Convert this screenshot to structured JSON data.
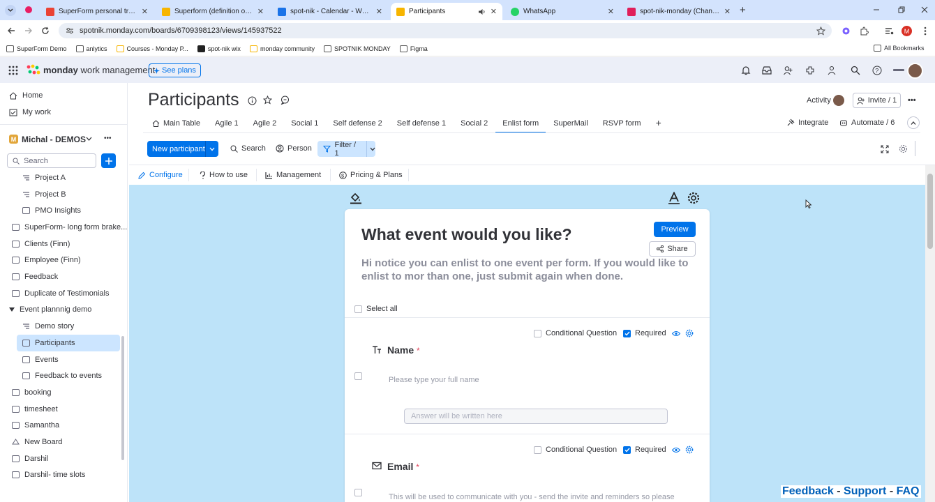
{
  "browser": {
    "tabs": [
      {
        "label": "SuperForm personal training -",
        "color": "#ea4335"
      },
      {
        "label": "Superform (definition of creati",
        "color": "#f7b500"
      },
      {
        "label": "spot-nik - Calendar - Week of J",
        "color": "#1a73e8"
      },
      {
        "label": "Participants",
        "color": "#f7b500",
        "active": true
      },
      {
        "label": "WhatsApp",
        "color": "#25d366"
      },
      {
        "label": "spot-nik-monday (Channel) - S",
        "color": "#e01e5a"
      }
    ],
    "close_glyph": "✕",
    "new_tab_glyph": "+",
    "url": "spotnik.monday.com/boards/6709398123/views/145937522",
    "profile_initial": "M",
    "bookmarks": [
      "SuperForm Demo",
      "anlytics",
      "Courses - Monday P...",
      "spot-nik wix",
      "monday community",
      "SPOTNIK MONDAY",
      "Figma"
    ],
    "all_bookmarks": "All Bookmarks"
  },
  "app": {
    "brand_bold": "monday",
    "brand_light": "work management",
    "see_plans": "See plans",
    "accent": "#0073ea"
  },
  "sidebar": {
    "home": "Home",
    "my_work": "My work",
    "workspace_initial": "M",
    "workspace": "Michal - DEMOS",
    "more": "•••",
    "search_placeholder": "Search",
    "items": [
      {
        "label": "Project A",
        "indent": true
      },
      {
        "label": "Project B",
        "indent": true
      },
      {
        "label": "PMO Insights",
        "indent": true
      },
      {
        "label": "SuperForm- long form brake..."
      },
      {
        "label": "Clients (Finn)"
      },
      {
        "label": "Employee (Finn)"
      },
      {
        "label": "Feedback"
      },
      {
        "label": "Duplicate of Testimonials"
      },
      {
        "label": "Event plannnig demo",
        "folder": true
      },
      {
        "label": "Demo story",
        "indent": true
      },
      {
        "label": "Participants",
        "indent": true,
        "selected": true
      },
      {
        "label": "Events",
        "indent": true
      },
      {
        "label": "Feedback to events",
        "indent": true
      },
      {
        "label": "booking"
      },
      {
        "label": "timesheet"
      },
      {
        "label": "Samantha"
      },
      {
        "label": "New Board"
      },
      {
        "label": "Darshil"
      },
      {
        "label": "Darshil- time slots"
      }
    ]
  },
  "board": {
    "title": "Participants",
    "activity": "Activity",
    "invite": "Invite / 1",
    "more": "•••",
    "tabs": [
      "Main Table",
      "Agile 1",
      "Agile 2",
      "Social 1",
      "Self defense 2",
      "Self defense 1",
      "Social 2",
      "Enlist form",
      "SuperMail",
      "RSVP form"
    ],
    "active_tab": "Enlist form",
    "add_tab": "+",
    "integrate": "Integrate",
    "automate": "Automate / 6",
    "new_item": "New participant",
    "search": "Search",
    "person": "Person",
    "filter": "Filter / 1"
  },
  "app_tabs": [
    {
      "label": "Configure",
      "icon": "pencil-icon",
      "active": true
    },
    {
      "label": "How to use",
      "icon": "question-icon"
    },
    {
      "label": "Management",
      "icon": "chart-icon"
    },
    {
      "label": "Pricing & Plans",
      "icon": "dollar-icon"
    }
  ],
  "form": {
    "title": "What event would you like?",
    "description": "Hi notice you can enlist to one event per form. If you would like to enlist to mor than one, just submit again when done.",
    "preview": "Preview",
    "share": "Share",
    "select_all": "Select all",
    "conditional": "Conditional Question",
    "required": "Required",
    "questions": [
      {
        "title": "Name",
        "star": "*",
        "hint": "Please type your full name",
        "answer_placeholder": "Answer will be written here"
      },
      {
        "title": "Email",
        "star": "*",
        "hint": "This will be used to communicate with you - send the invite and reminders so please",
        "answer_placeholder": ""
      }
    ]
  },
  "footer": {
    "feedback": "Feedback",
    "support": "Support",
    "faq": "FAQ",
    "sep": "-"
  }
}
